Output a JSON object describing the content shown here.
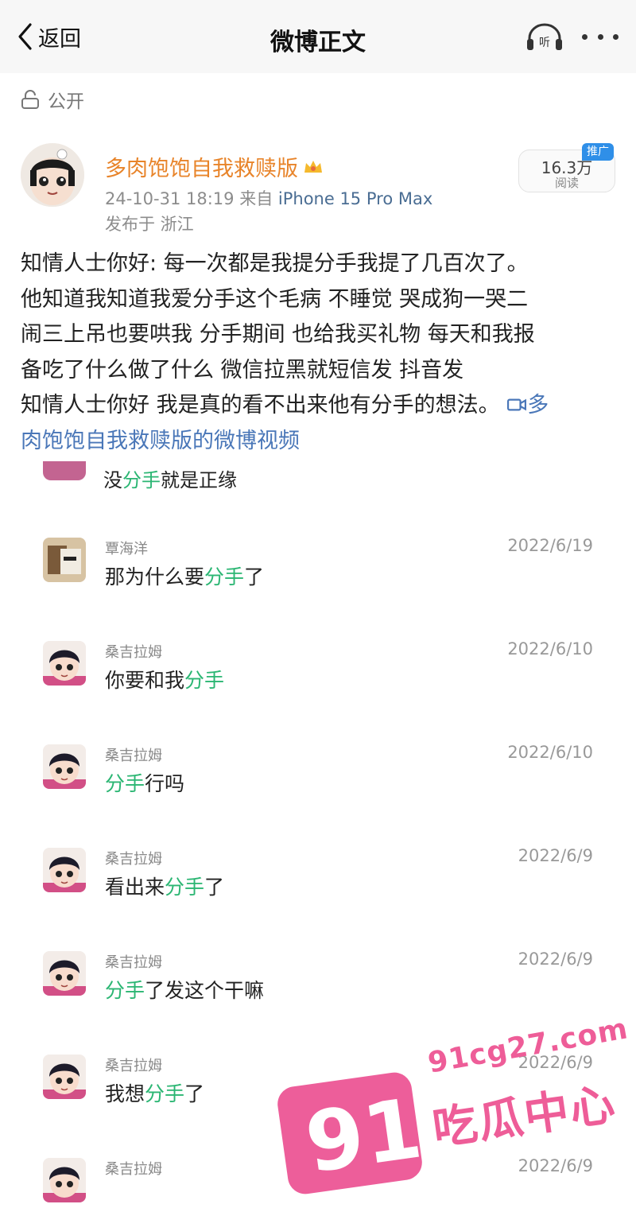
{
  "nav": {
    "back_label": "返回",
    "title": "微博正文",
    "listen_label": "听"
  },
  "post": {
    "visibility": "公开",
    "author": "多肉饱饱自我救赎版",
    "date": "24-10-31 18:19",
    "from_prefix": "来自",
    "device": "iPhone 15 Pro Max",
    "location": "发布于 浙江",
    "reads": "16.3万",
    "reads_label": "阅读",
    "promo": "推广",
    "lines": [
      "知情人士你好: 每一次都是我提分手我提了几百次了。",
      "他知道我知道我爱分手这个毛病 不睡觉 哭成狗一哭二",
      "闹三上吊也要哄我 分手期间 也给我买礼物 每天和我报",
      "备吃了什么做了什么 微信拉黑就短信发 抖音发",
      "知情人士你好 我是真的看不出来他有分手的想法。"
    ],
    "video_link_1": "多",
    "video_link_2": "肉饱饱自我救赎版的微博视频"
  },
  "chat": {
    "top_cut_before": "没",
    "top_cut_hl": "分手",
    "top_cut_after": "就是正缘",
    "messages": [
      {
        "name": "覃海洋",
        "date": "2022/6/19",
        "before": "那为什么要",
        "hl": "分手",
        "after": "了"
      },
      {
        "name": "桑吉拉姆",
        "date": "2022/6/10",
        "before": "你要和我",
        "hl": "分手",
        "after": ""
      },
      {
        "name": "桑吉拉姆",
        "date": "2022/6/10",
        "before": "",
        "hl": "分手",
        "after": "行吗"
      },
      {
        "name": "桑吉拉姆",
        "date": "2022/6/9",
        "before": "看出来",
        "hl": "分手",
        "after": "了"
      },
      {
        "name": "桑吉拉姆",
        "date": "2022/6/9",
        "before": "",
        "hl": "分手",
        "after": "了发这个干嘛"
      },
      {
        "name": "桑吉拉姆",
        "date": "2022/6/9",
        "before": "我想",
        "hl": "分手",
        "after": "了"
      },
      {
        "name": "桑吉拉姆",
        "date": "2022/6/9",
        "before": "",
        "hl": "",
        "after": ""
      }
    ]
  },
  "watermark": {
    "url": "91cg27.com",
    "number": "91",
    "text": "吃瓜中心"
  },
  "colors": {
    "highlight": "#2bb673",
    "author": "#e8842a",
    "link": "#4a77b8",
    "watermark": "#ee5d98"
  }
}
